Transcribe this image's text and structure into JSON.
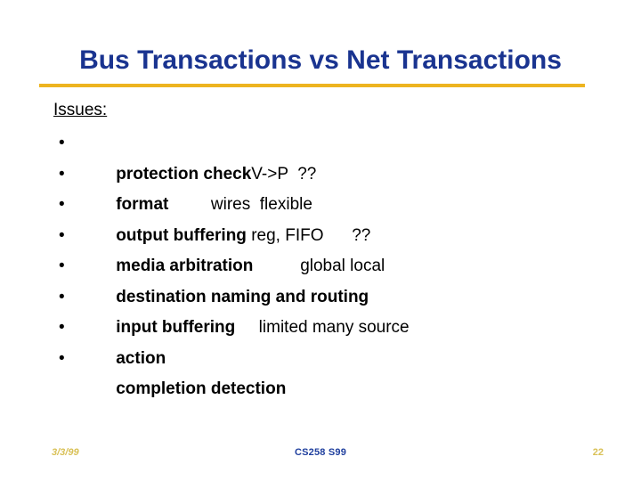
{
  "slide": {
    "title": "Bus Transactions vs Net Transactions",
    "accent_rule_color": "#edb41f",
    "title_color": "#1a3490",
    "background_color": "#ffffff",
    "heading": "Issues:",
    "bullet_marker": "•",
    "bullets": [
      {
        "term": "protection check",
        "detail": "V->P",
        "extra": "??"
      },
      {
        "term": "format",
        "detail": "wires",
        "extra": "flexible"
      },
      {
        "term": "output buffering",
        "detail": " reg, FIFO",
        "extra": "??"
      },
      {
        "term": "media arbitration",
        "detail": "",
        "extra": "global local"
      },
      {
        "term": "destination naming and routing",
        "detail": "",
        "extra": ""
      },
      {
        "term": "input buffering",
        "detail": "limited",
        "extra": "many source"
      },
      {
        "term": "action",
        "detail": "",
        "extra": ""
      },
      {
        "term": "completion detection",
        "detail": "",
        "extra": ""
      }
    ],
    "bullet_gaps": [
      {
        "before_detail": "",
        "before_extra": "  "
      },
      {
        "before_detail": "         ",
        "before_extra": "  "
      },
      {
        "before_detail": "",
        "before_extra": "      "
      },
      {
        "before_detail": "",
        "before_extra": "          "
      },
      {
        "before_detail": "",
        "before_extra": ""
      },
      {
        "before_detail": "     ",
        "before_extra": " "
      },
      {
        "before_detail": "",
        "before_extra": ""
      },
      {
        "before_detail": "",
        "before_extra": ""
      }
    ]
  },
  "footer": {
    "date": "3/3/99",
    "course": "CS258 S99",
    "page_number": "22",
    "date_color": "#d9c157",
    "course_color": "#1f3f9e"
  }
}
